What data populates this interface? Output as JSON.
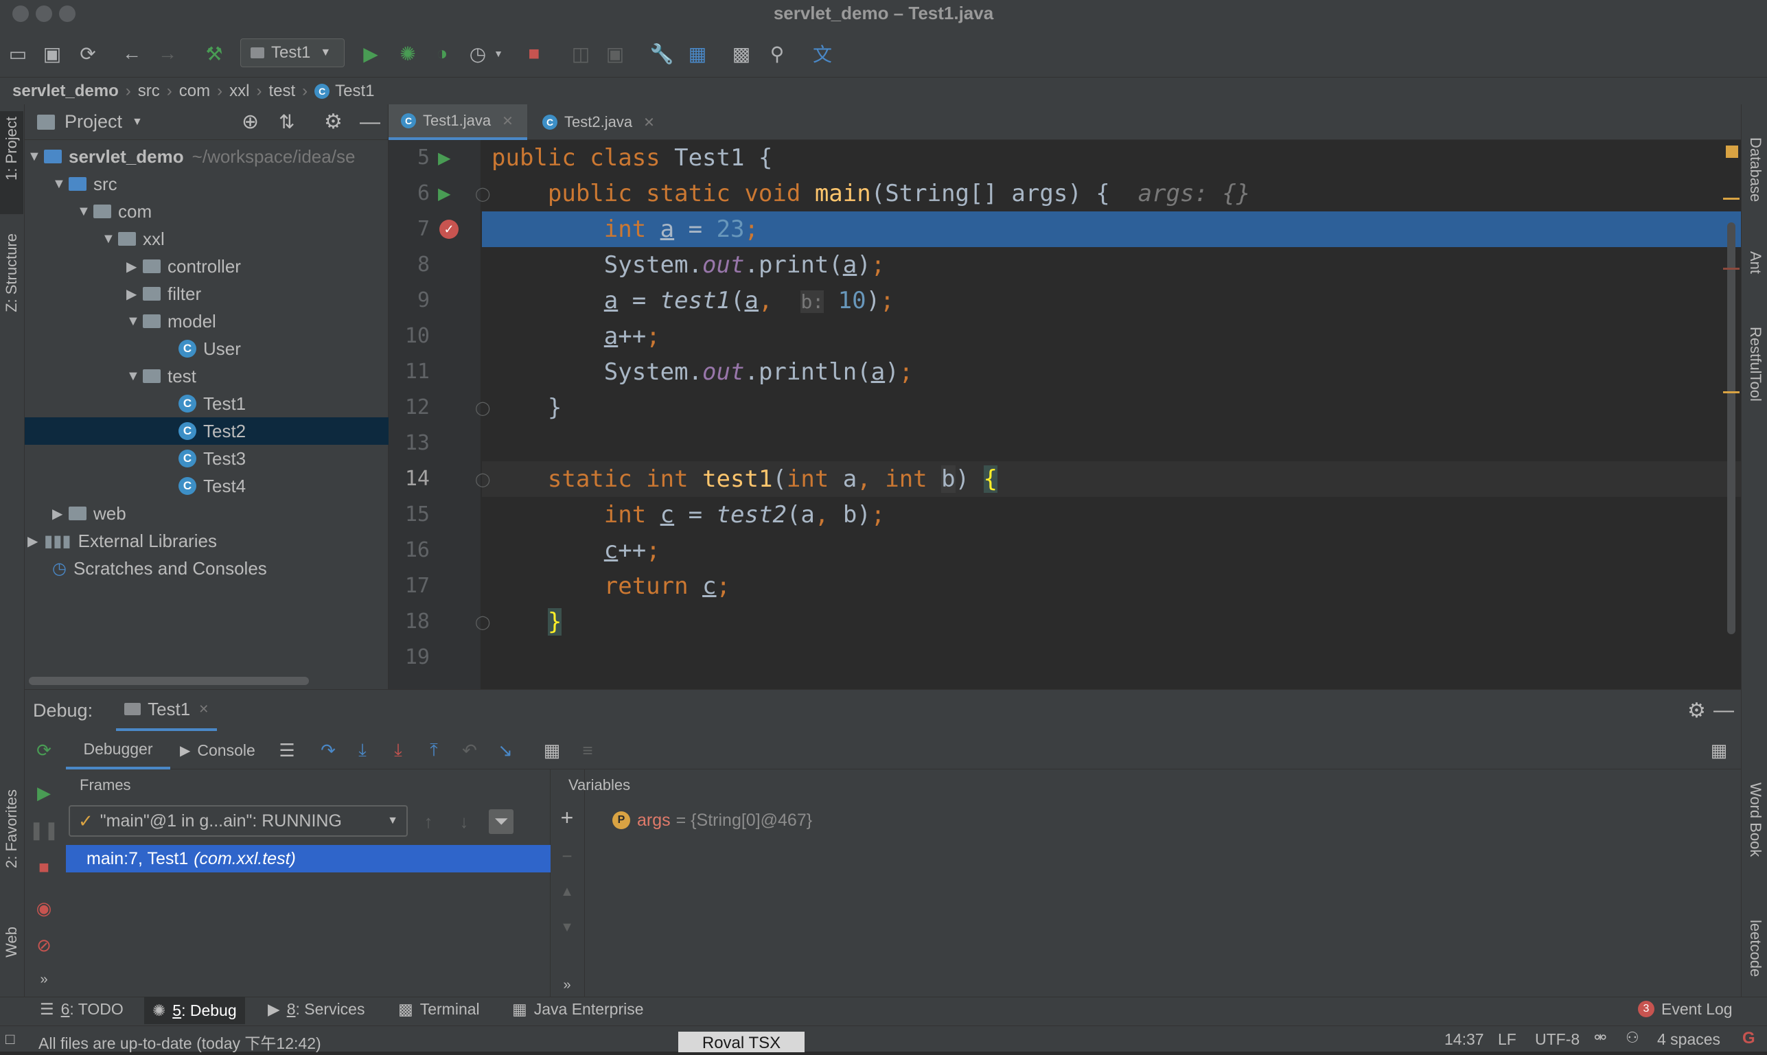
{
  "window": {
    "title": "servlet_demo – Test1.java"
  },
  "toolbar": {
    "run_config": "Test1"
  },
  "breadcrumb": [
    "servlet_demo",
    "src",
    "com",
    "xxl",
    "test",
    "Test1"
  ],
  "project_panel": {
    "title": "Project",
    "tree": [
      {
        "label": "servlet_demo",
        "suffix": "~/workspace/idea/se",
        "type": "module"
      },
      {
        "label": "src",
        "type": "folder-blue"
      },
      {
        "label": "com",
        "type": "folder"
      },
      {
        "label": "xxl",
        "type": "folder"
      },
      {
        "label": "controller",
        "type": "folder"
      },
      {
        "label": "filter",
        "type": "folder"
      },
      {
        "label": "model",
        "type": "folder"
      },
      {
        "label": "User",
        "type": "class"
      },
      {
        "label": "test",
        "type": "folder"
      },
      {
        "label": "Test1",
        "type": "class"
      },
      {
        "label": "Test2",
        "type": "class",
        "selected": true
      },
      {
        "label": "Test3",
        "type": "class"
      },
      {
        "label": "Test4",
        "type": "class"
      },
      {
        "label": "web",
        "type": "folder"
      },
      {
        "label": "External Libraries",
        "type": "lib"
      },
      {
        "label": "Scratches and Consoles",
        "type": "scratch"
      }
    ]
  },
  "left_strip": {
    "project": "1: Project",
    "structure": "Z: Structure",
    "favorites": "2: Favorites",
    "web": "Web"
  },
  "right_strip": {
    "database": "Database",
    "ant": "Ant",
    "restful": "RestfulTool",
    "wordbook": "Word Book",
    "leetcode": "leetcode"
  },
  "editor": {
    "tabs": [
      {
        "label": "Test1.java",
        "active": true
      },
      {
        "label": "Test2.java",
        "active": false
      }
    ],
    "line_numbers": [
      "5",
      "6",
      "7",
      "8",
      "9",
      "10",
      "11",
      "12",
      "13",
      "14",
      "15",
      "16",
      "17",
      "18",
      "19"
    ],
    "hint_args": "args: {}",
    "hint_param_b": "b:"
  },
  "debug": {
    "label": "Debug:",
    "session_tab": "Test1",
    "tabs": {
      "debugger": "Debugger",
      "console": "Console"
    },
    "frames_header": "Frames",
    "thread": "\"main\"@1 in g...ain\": RUNNING",
    "frame": "main:7, Test1",
    "frame_pkg": "(com.xxl.test)",
    "variables_header": "Variables",
    "variable": {
      "name": "args",
      "value": "= {String[0]@467}"
    }
  },
  "bottom_tabs": [
    {
      "key": "6",
      "label": ": TODO"
    },
    {
      "key": "5",
      "label": ": Debug"
    },
    {
      "key": "8",
      "label": ": Services"
    },
    {
      "key": "",
      "label": "Terminal"
    },
    {
      "key": "",
      "label": "Java Enterprise"
    }
  ],
  "event_log": {
    "count": "3",
    "label": "Event Log"
  },
  "status_bar": {
    "message": "All files are up-to-date (today 下午12:42)",
    "overlay": "Roval TSX",
    "position": "14:37",
    "line_sep": "LF",
    "encoding": "UTF-8",
    "indent": "4 spaces"
  },
  "colors": {
    "accent": "#2f65ca",
    "selection": "#0d293e",
    "exec_line": "#2d6099",
    "keyword": "#cc7832",
    "number": "#6897bb",
    "method": "#ffc66d"
  }
}
